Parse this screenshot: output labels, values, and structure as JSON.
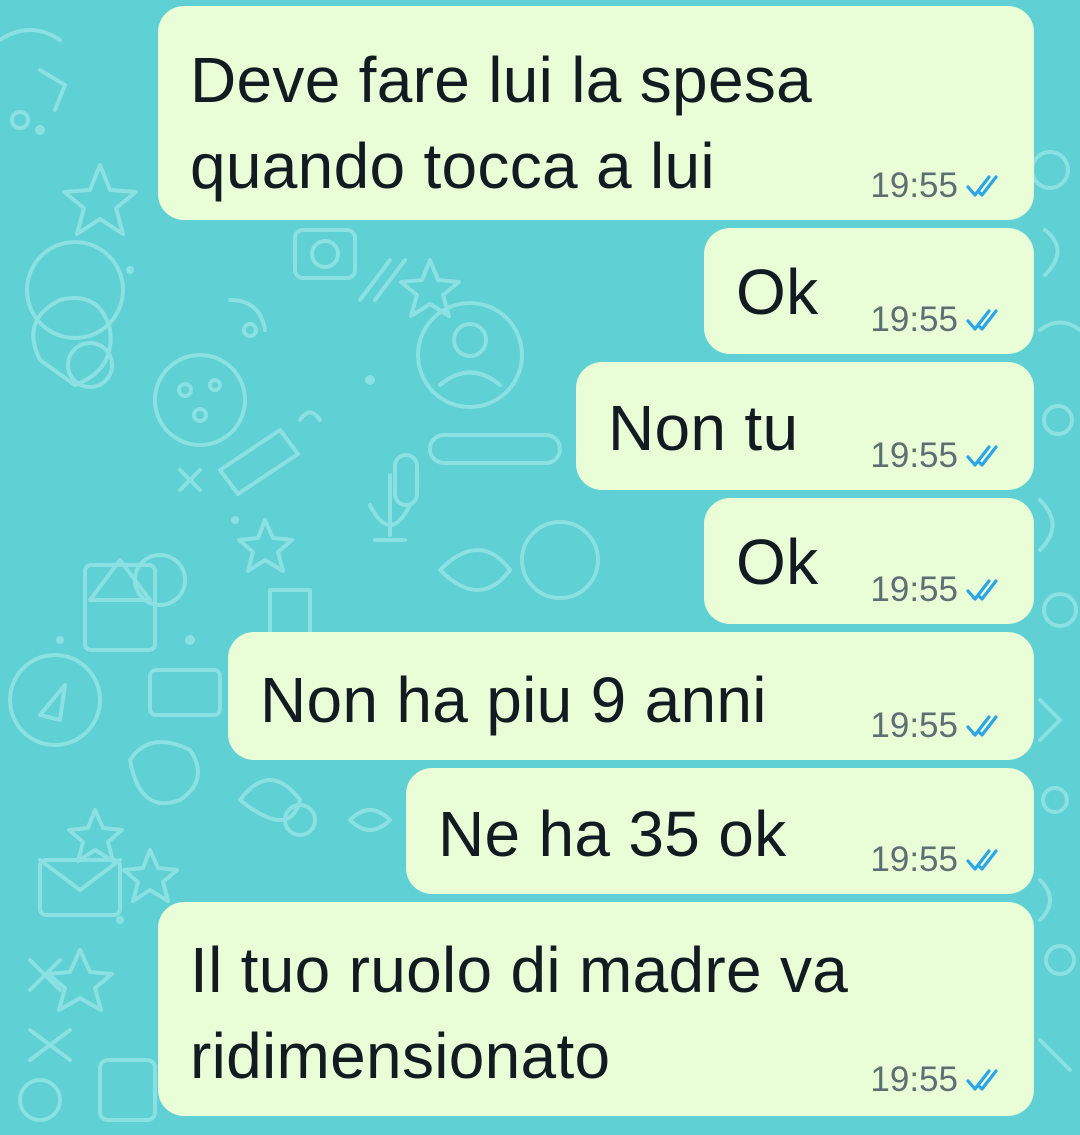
{
  "chat": {
    "messages": [
      {
        "lines": [
          "Deve fare lui la spesa",
          "quando tocca a lui"
        ],
        "time": "19:55",
        "status_icon": "double-check-read-icon"
      },
      {
        "lines": [
          "Ok"
        ],
        "time": "19:55",
        "status_icon": "double-check-read-icon"
      },
      {
        "lines": [
          "Non tu"
        ],
        "time": "19:55",
        "status_icon": "double-check-read-icon"
      },
      {
        "lines": [
          "Ok"
        ],
        "time": "19:55",
        "status_icon": "double-check-read-icon"
      },
      {
        "lines": [
          "Non ha piu 9 anni"
        ],
        "time": "19:55",
        "status_icon": "double-check-read-icon"
      },
      {
        "lines": [
          "Ne ha 35 ok"
        ],
        "time": "19:55",
        "status_icon": "double-check-read-icon"
      },
      {
        "lines": [
          "Il tuo ruolo di madre va",
          "ridimensionato"
        ],
        "time": "19:55",
        "status_icon": "double-check-read-icon"
      }
    ]
  },
  "colors": {
    "background": "#5fd0d3",
    "bubble_outgoing": "#e9fdd6",
    "read_tick": "#2aa5e6",
    "time_text": "#5e6f74"
  }
}
